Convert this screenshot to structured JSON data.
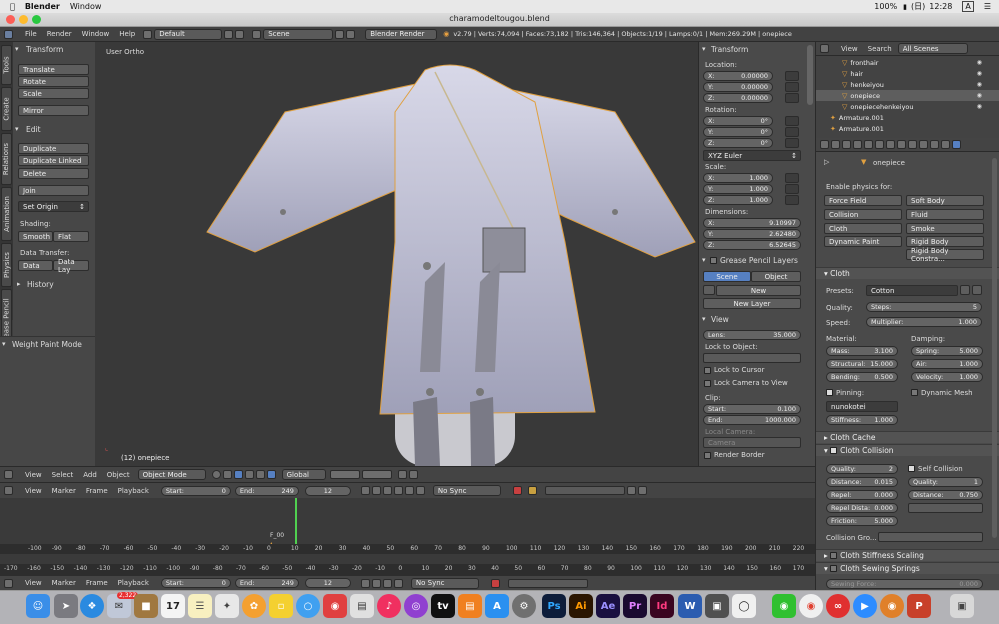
{
  "mac": {
    "app_name": "Blender",
    "menu_window": "Window",
    "battery": "100%",
    "day": "(日)",
    "time": "12:28",
    "input_indicator": "A"
  },
  "window": {
    "title": "charamodeltougou.blend"
  },
  "info": {
    "menus": [
      "File",
      "Render",
      "Window",
      "Help"
    ],
    "layout": "Default",
    "scene": "Scene",
    "engine": "Blender Render",
    "stats": "v2.79 | Verts:74,094 | Faces:73,182 | Tris:146,364 | Objects:1/19 | Lamps:0/1 | Mem:269.29M | onepiece"
  },
  "tabs": [
    "Tools",
    "Create",
    "Relations",
    "Animation",
    "Physics",
    "Grease Pencil"
  ],
  "toolshelf": {
    "transform_header": "Transform",
    "translate": "Translate",
    "rotate": "Rotate",
    "scale": "Scale",
    "mirror": "Mirror",
    "edit_header": "Edit",
    "duplicate": "Duplicate",
    "duplicate_linked": "Duplicate Linked",
    "delete": "Delete",
    "join": "Join",
    "set_origin": "Set Origin",
    "shading_label": "Shading:",
    "smooth": "Smooth",
    "flat": "Flat",
    "data_transfer_label": "Data Transfer:",
    "data": "Data",
    "data_lay": "Data Lay",
    "history": "History",
    "weight_paint_mode": "Weight Paint Mode"
  },
  "viewport": {
    "view_name": "User Ortho",
    "object_label": "(12) onepiece"
  },
  "npanel": {
    "transform": "Transform",
    "location": "Location:",
    "loc_x": "X:",
    "loc_x_val": "0.00000",
    "loc_y": "Y:",
    "loc_y_val": "0.00000",
    "loc_z": "Z:",
    "loc_z_val": "0.00000",
    "rotation": "Rotation:",
    "rot_x": "X:",
    "rot_x_val": "0°",
    "rot_y": "Y:",
    "rot_y_val": "0°",
    "rot_z": "Z:",
    "rot_z_val": "0°",
    "euler": "XYZ Euler",
    "scale_label": "Scale:",
    "sc_x": "X:",
    "sc_x_val": "1.000",
    "sc_y": "Y:",
    "sc_y_val": "1.000",
    "sc_z": "Z:",
    "sc_z_val": "1.000",
    "dimensions": "Dimensions:",
    "dim_x": "X:",
    "dim_x_val": "9.10997",
    "dim_y": "Y:",
    "dim_y_val": "2.62480",
    "dim_z": "Z:",
    "dim_z_val": "6.52645",
    "gp_layers": "Grease Pencil Layers",
    "scene_tab": "Scene",
    "object_tab": "Object",
    "new": "New",
    "new_layer": "New Layer",
    "view": "View",
    "lens": "Lens:",
    "lens_val": "35.000",
    "lock_to_object": "Lock to Object:",
    "lock_to_cursor": "Lock to Cursor",
    "lock_camera": "Lock Camera to View",
    "clip": "Clip:",
    "clip_start": "Start:",
    "clip_start_val": "0.100",
    "clip_end": "End:",
    "clip_end_val": "1000.000",
    "local_camera": "Local Camera:",
    "camera": "Camera",
    "render_border": "Render Border"
  },
  "vheader": {
    "menus": [
      "View",
      "Select",
      "Add",
      "Object"
    ],
    "mode": "Object Mode",
    "orientation": "Global"
  },
  "timeline": {
    "menus": [
      "View",
      "Marker",
      "Frame",
      "Playback"
    ],
    "start_label": "Start:",
    "start_val": "0",
    "end_label": "End:",
    "end_val": "249",
    "current": "12",
    "sync": "No Sync",
    "marker": "F_00",
    "ruler_top": [
      "-100",
      "-90",
      "-80",
      "-70",
      "-60",
      "-50",
      "-40",
      "-30",
      "-20",
      "-10",
      "0",
      "10",
      "20",
      "30",
      "40",
      "50",
      "60",
      "70",
      "80",
      "90",
      "100",
      "110",
      "120",
      "130",
      "140",
      "150",
      "160",
      "170",
      "180",
      "190",
      "200",
      "210",
      "220"
    ],
    "ruler_bottom": [
      "-170",
      "-160",
      "-150",
      "-140",
      "-130",
      "-120",
      "-110",
      "-100",
      "-90",
      "-80",
      "-70",
      "-60",
      "-50",
      "-40",
      "-30",
      "-20",
      "-10",
      "0",
      "10",
      "20",
      "30",
      "40",
      "50",
      "60",
      "70",
      "80",
      "90",
      "100",
      "110",
      "120",
      "130",
      "140",
      "150",
      "160",
      "170"
    ]
  },
  "outliner": {
    "view": "View",
    "search": "Search",
    "scope": "All Scenes",
    "items": [
      "fronthair",
      "hair",
      "henkeiyou",
      "onepiece",
      "onepiecehenkeiyou",
      "Armature.001",
      "Armature.001"
    ]
  },
  "props": {
    "object_name": "onepiece",
    "enable_physics": "Enable physics for:",
    "force_field": "Force Field",
    "soft_body": "Soft Body",
    "collision": "Collision",
    "fluid": "Fluid",
    "cloth_btn": "Cloth",
    "smoke": "Smoke",
    "dynamic_paint": "Dynamic Paint",
    "rigid_body": "Rigid Body",
    "rigid_body_constraint": "Rigid Body Constra...",
    "cloth": "Cloth",
    "presets": "Presets:",
    "preset_val": "Cotton",
    "quality": "Quality:",
    "steps": "Steps:",
    "steps_val": "5",
    "speed": "Speed:",
    "multiplier": "Multiplier:",
    "multiplier_val": "1.000",
    "material": "Material:",
    "damping": "Damping:",
    "mass": "Mass:",
    "mass_val": "3.100",
    "spring": "Spring:",
    "spring_val": "5.000",
    "structural": "Structural:",
    "structural_val": "15.000",
    "air": "Air:",
    "air_val": "1.000",
    "bending": "Bending:",
    "bending_val": "0.500",
    "velocity": "Velocity:",
    "velocity_val": "1.000",
    "pinning": "Pinning:",
    "dynamic_mesh": "Dynamic Mesh",
    "pin_group": "nunokotei",
    "stiffness": "Stiffness:",
    "stiffness_val": "1.000",
    "cloth_cache": "Cloth Cache",
    "cloth_collision": "Cloth Collision",
    "c_quality": "Quality:",
    "c_quality_val": "2",
    "self_collision": "Self Collision",
    "distance": "Distance:",
    "distance_val": "0.015",
    "s_quality": "Quality:",
    "s_quality_val": "1",
    "repel": "Repel:",
    "repel_val": "0.000",
    "s_distance": "Distance:",
    "s_distance_val": "0.750",
    "repel_dist": "Repel Dista:",
    "repel_dist_val": "0.000",
    "friction": "Friction:",
    "friction_val": "5.000",
    "collision_group": "Collision Gro...",
    "stiffness_scaling": "Cloth Stiffness Scaling",
    "sewing_springs": "Cloth Sewing Springs",
    "sewing_force": "Sewing Force:",
    "sewing_force_val": "0.000"
  },
  "dock": {
    "calendar_day": "17",
    "mail_badge": "2,322",
    "apps": [
      "Ps",
      "Ai",
      "Ae",
      "Pr",
      "Id"
    ]
  }
}
